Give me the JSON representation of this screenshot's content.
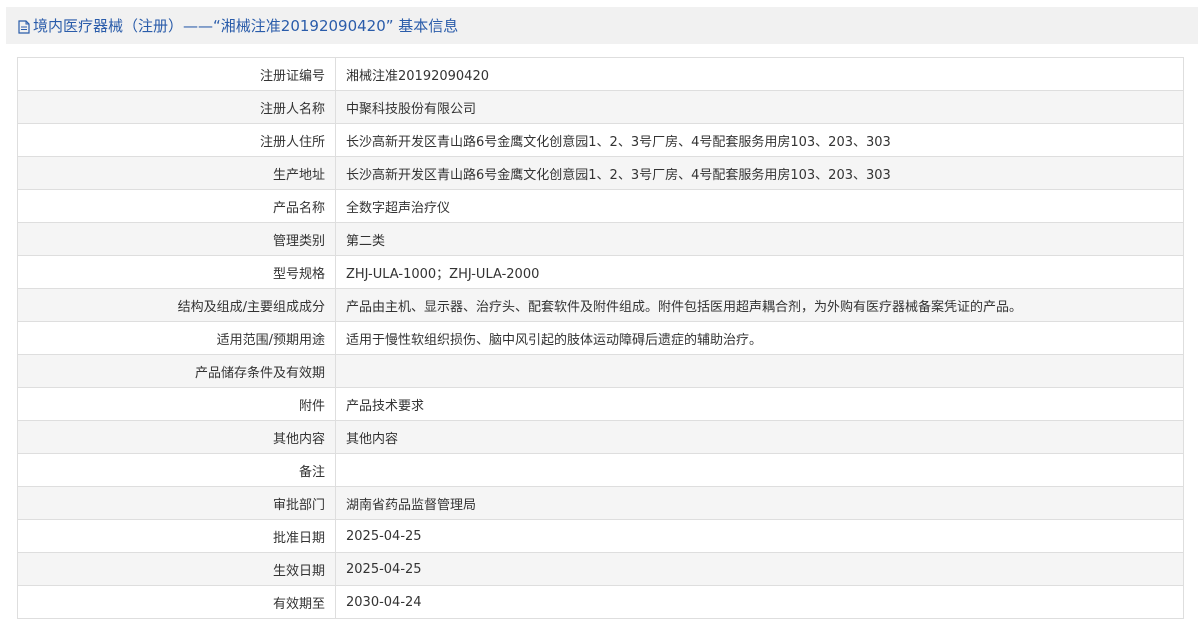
{
  "header": {
    "title": "境内医疗器械（注册）——“湘械注准20192090420” 基本信息"
  },
  "rows": [
    {
      "label": "注册证编号",
      "value": "湘械注准20192090420"
    },
    {
      "label": "注册人名称",
      "value": "中聚科技股份有限公司"
    },
    {
      "label": "注册人住所",
      "value": "长沙高新开发区青山路6号金鹰文化创意园1、2、3号厂房、4号配套服务用房103、203、303"
    },
    {
      "label": "生产地址",
      "value": "长沙高新开发区青山路6号金鹰文化创意园1、2、3号厂房、4号配套服务用房103、203、303"
    },
    {
      "label": "产品名称",
      "value": "全数字超声治疗仪"
    },
    {
      "label": "管理类别",
      "value": "第二类"
    },
    {
      "label": "型号规格",
      "value": "ZHJ-ULA-1000；ZHJ-ULA-2000"
    },
    {
      "label": "结构及组成/主要组成成分",
      "value": "产品由主机、显示器、治疗头、配套软件及附件组成。附件包括医用超声耦合剂，为外购有医疗器械备案凭证的产品。"
    },
    {
      "label": "适用范围/预期用途",
      "value": "适用于慢性软组织损伤、脑中风引起的肢体运动障碍后遗症的辅助治疗。"
    },
    {
      "label": "产品储存条件及有效期",
      "value": ""
    },
    {
      "label": "附件",
      "value": "产品技术要求"
    },
    {
      "label": "其他内容",
      "value": "其他内容"
    },
    {
      "label": "备注",
      "value": ""
    },
    {
      "label": "审批部门",
      "value": "湖南省药品监督管理局"
    },
    {
      "label": "批准日期",
      "value": "2025-04-25"
    },
    {
      "label": "生效日期",
      "value": "2025-04-25"
    },
    {
      "label": "有效期至",
      "value": "2030-04-24"
    }
  ]
}
